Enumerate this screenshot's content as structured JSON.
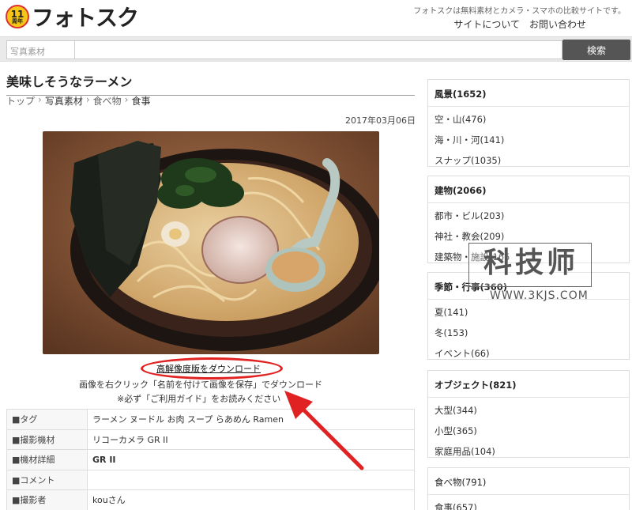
{
  "header": {
    "logo_badge": "11",
    "logo_badge_sub": "周年",
    "logo_text": "フォトスク",
    "tagline": "フォトスクは無料素材とカメラ・スマホの比較サイトです。",
    "nav": [
      "サイトについて",
      "お問い合わせ"
    ]
  },
  "search": {
    "category": "写真素材",
    "placeholder": "",
    "button": "検索"
  },
  "main": {
    "title": "美味しそうなラーメン",
    "breadcrumb": [
      "トップ",
      "写真素材",
      "食べ物",
      "食事"
    ],
    "date": "2017年03月06日",
    "download_link": "高解像度版をダウンロード",
    "instruction1": "画像を右クリック「名前を付けて画像を保存」でダウンロード",
    "instruction2": "※必ず「ご利用ガイド」をお読みください",
    "info_rows": [
      {
        "key": "■タグ",
        "value": "ラーメン ヌードル お肉 スープ らあめん Ramen"
      },
      {
        "key": "■撮影機材",
        "value": "リコーカメラ GR II"
      },
      {
        "key": "■機材詳細",
        "value": "GR II"
      },
      {
        "key": "■コメント",
        "value": ""
      },
      {
        "key": "■撮影者",
        "value": "kouさん"
      }
    ]
  },
  "sidebar": {
    "categories": [
      {
        "title": "風景(1652)",
        "items": [
          "空・山(476)",
          "海・川・河(141)",
          "スナップ(1035)"
        ]
      },
      {
        "title": "建物(2066)",
        "items": [
          "都市・ビル(203)",
          "神社・教会(209)",
          "建築物・施設(165"
        ]
      },
      {
        "title": "季節・行事(360)",
        "items": [
          "夏(141)",
          "冬(153)",
          "イベント(66)"
        ]
      },
      {
        "title": "オブジェクト(821)",
        "items": [
          "大型(344)",
          "小型(365)",
          "家庭用品(104)"
        ]
      },
      {
        "title": "食べ物(791)",
        "items": [
          "食事(657)"
        ]
      }
    ]
  },
  "watermark": {
    "text": "科技师",
    "url": "WWW.3KJS.COM"
  },
  "colors": {
    "annotation_red": "#e12222",
    "search_button": "#555555"
  }
}
